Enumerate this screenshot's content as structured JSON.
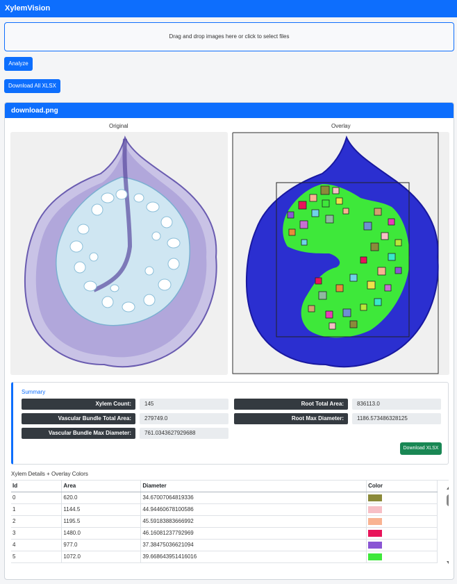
{
  "app": {
    "title": "XylemVision"
  },
  "upload": {
    "dropzone_text": "Drag and drop images here or click to select files"
  },
  "actions": {
    "analyze_label": "Analyze",
    "download_all_label": "Download All XLSX"
  },
  "result": {
    "filename": "download.png",
    "original_label": "Original",
    "overlay_label": "Overlay",
    "summary": {
      "title": "Summary",
      "xylem_count_label": "Xylem Count:",
      "xylem_count_value": "145",
      "root_total_area_label": "Root Total Area:",
      "root_total_area_value": "836113.0",
      "vb_total_area_label": "Vascular Bundle Total Area:",
      "vb_total_area_value": "279749.0",
      "root_max_diameter_label": "Root Max Diameter:",
      "root_max_diameter_value": "1186.573486328125",
      "vb_max_diameter_label": "Vascular Bundle Max Diameter:",
      "vb_max_diameter_value": "761.0343627929688",
      "download_xlsx_label": "Download XLSX"
    },
    "details": {
      "title": "Xylem Details + Overlay Colors",
      "columns": [
        "Id",
        "Area",
        "Diameter",
        "Color"
      ],
      "rows": [
        {
          "id": "0",
          "area": "620.0",
          "diameter": "34.67007064819336",
          "color": "#8b8a3a"
        },
        {
          "id": "1",
          "area": "1144.5",
          "diameter": "44.94460678100586",
          "color": "#f7bfc6"
        },
        {
          "id": "2",
          "area": "1195.5",
          "diameter": "45.59183883666992",
          "color": "#f9b392"
        },
        {
          "id": "3",
          "area": "1480.0",
          "diameter": "46.16081237792969",
          "color": "#e8145a"
        },
        {
          "id": "4",
          "area": "977.0",
          "diameter": "37.38475036621094",
          "color": "#8a55d4"
        },
        {
          "id": "5",
          "area": "1072.0",
          "diameter": "39.668643951416016",
          "color": "#3ee83a"
        }
      ]
    }
  }
}
